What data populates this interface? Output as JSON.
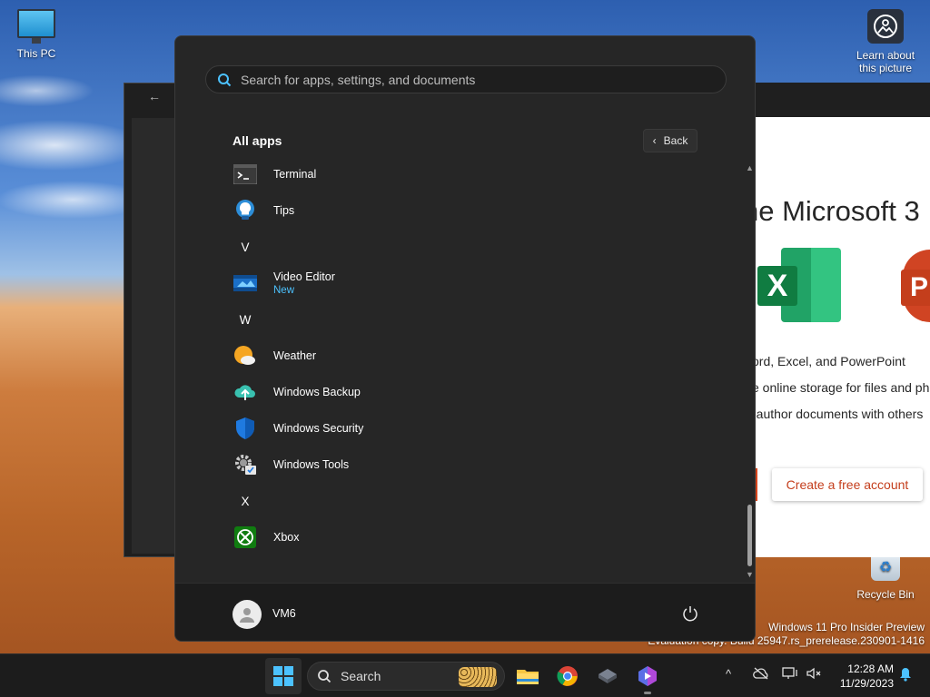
{
  "desktop": {
    "icons": [
      {
        "label": "This PC"
      },
      {
        "label": "Learn about this picture"
      },
      {
        "label": "Recycle Bin"
      }
    ],
    "watermark_line1": "Windows 11 Pro Insider Preview",
    "watermark_line2": "Evaluation copy. Build 25947.rs_prerelease.230901-1416"
  },
  "background_window": {
    "heading": "he Microsoft 3",
    "features": [
      "ord, Excel, and PowerPoint",
      "e online storage for files and ph",
      "-author documents with others"
    ],
    "create_button": "Create a free account"
  },
  "start_menu": {
    "search_placeholder": "Search for apps, settings, and documents",
    "all_apps_title": "All apps",
    "back_label": "Back",
    "apps": [
      {
        "type": "app",
        "name": "Terminal",
        "icon": "terminal-icon"
      },
      {
        "type": "app",
        "name": "Tips",
        "icon": "tips-icon"
      },
      {
        "type": "letter",
        "name": "V"
      },
      {
        "type": "app",
        "name": "Video Editor",
        "badge": "New",
        "icon": "video-editor-icon"
      },
      {
        "type": "letter",
        "name": "W"
      },
      {
        "type": "app",
        "name": "Weather",
        "icon": "weather-icon"
      },
      {
        "type": "app",
        "name": "Windows Backup",
        "icon": "windows-backup-icon"
      },
      {
        "type": "app",
        "name": "Windows Security",
        "icon": "windows-security-icon"
      },
      {
        "type": "app",
        "name": "Windows Tools",
        "icon": "windows-tools-icon"
      },
      {
        "type": "letter",
        "name": "X"
      },
      {
        "type": "app",
        "name": "Xbox",
        "icon": "xbox-icon"
      }
    ],
    "user_name": "VM6"
  },
  "taskbar": {
    "search_label": "Search",
    "time": "12:28 AM",
    "date": "11/29/2023"
  },
  "colors": {
    "accent": "#4cc2ff",
    "menu_bg": "#262626",
    "taskbar_bg": "#1c1c1c"
  }
}
